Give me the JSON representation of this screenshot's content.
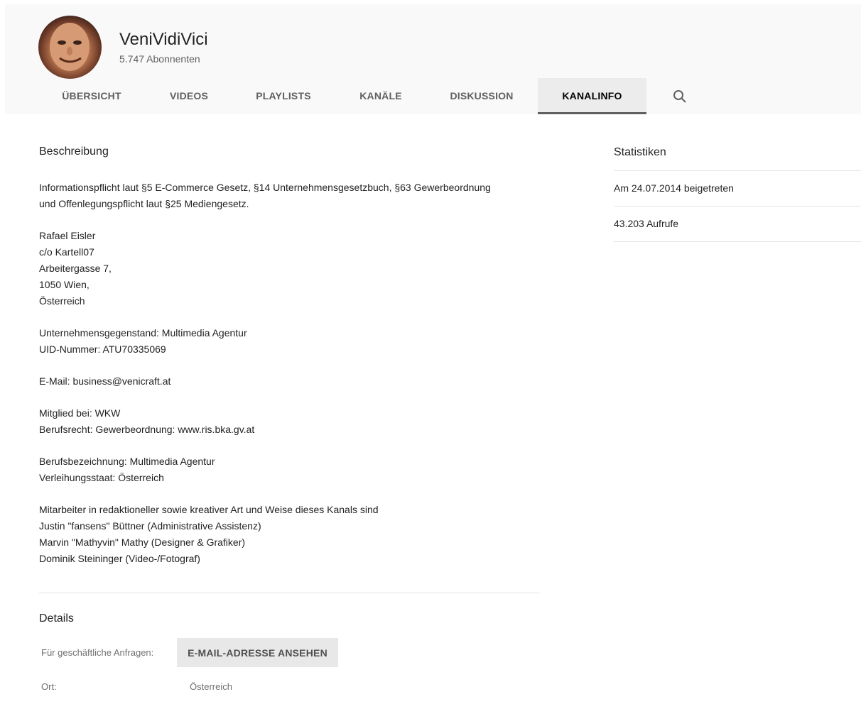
{
  "channel": {
    "name": "VeniVidiVici",
    "subscribers": "5.747 Abonnenten"
  },
  "tabs": [
    {
      "label": "ÜBERSICHT"
    },
    {
      "label": "VIDEOS"
    },
    {
      "label": "PLAYLISTS"
    },
    {
      "label": "KANÄLE"
    },
    {
      "label": "DISKUSSION"
    },
    {
      "label": "KANALINFO",
      "active": true
    }
  ],
  "search_icon": "search-icon",
  "description": {
    "title": "Beschreibung",
    "paragraphs": [
      [
        "Informationspflicht laut §5 E-Commerce Gesetz, §14 Unternehmensgesetzbuch, §63 Gewerbeordnung",
        "und Offenlegungspflicht laut §25 Mediengesetz."
      ],
      [
        "Rafael Eisler",
        "c/o Kartell07",
        "Arbeitergasse 7,",
        "1050 Wien,",
        "Österreich"
      ],
      [
        "Unternehmensgegenstand: Multimedia Agentur",
        "UID-Nummer: ATU70335069"
      ],
      [
        "E-Mail: business@venicraft.at"
      ],
      [
        "Mitglied bei: WKW",
        "Berufsrecht: Gewerbeordnung: www.ris.bka.gv.at"
      ],
      [
        "Berufsbezeichnung: Multimedia Agentur",
        "Verleihungsstaat: Österreich"
      ],
      [
        "Mitarbeiter in redaktioneller sowie kreativer Art und Weise dieses Kanals sind",
        "Justin \"fansens\" Büttner (Administrative Assistenz)",
        "Marvin \"Mathyvin\" Mathy (Designer & Grafiker)",
        "Dominik Steininger (Video-/Fotograf)"
      ]
    ]
  },
  "details": {
    "title": "Details",
    "business_label": "Für geschäftliche Anfragen:",
    "email_button": "E-MAIL-ADRESSE ANSEHEN",
    "location_label": "Ort:",
    "location_value": "Österreich"
  },
  "stats": {
    "title": "Statistiken",
    "joined": "Am 24.07.2014 beigetreten",
    "views": "43.203 Aufrufe"
  },
  "colors": {
    "header_bg": "#f9f9f9",
    "active_tab_bg": "#ececec",
    "button_bg": "#e8e8e8"
  }
}
